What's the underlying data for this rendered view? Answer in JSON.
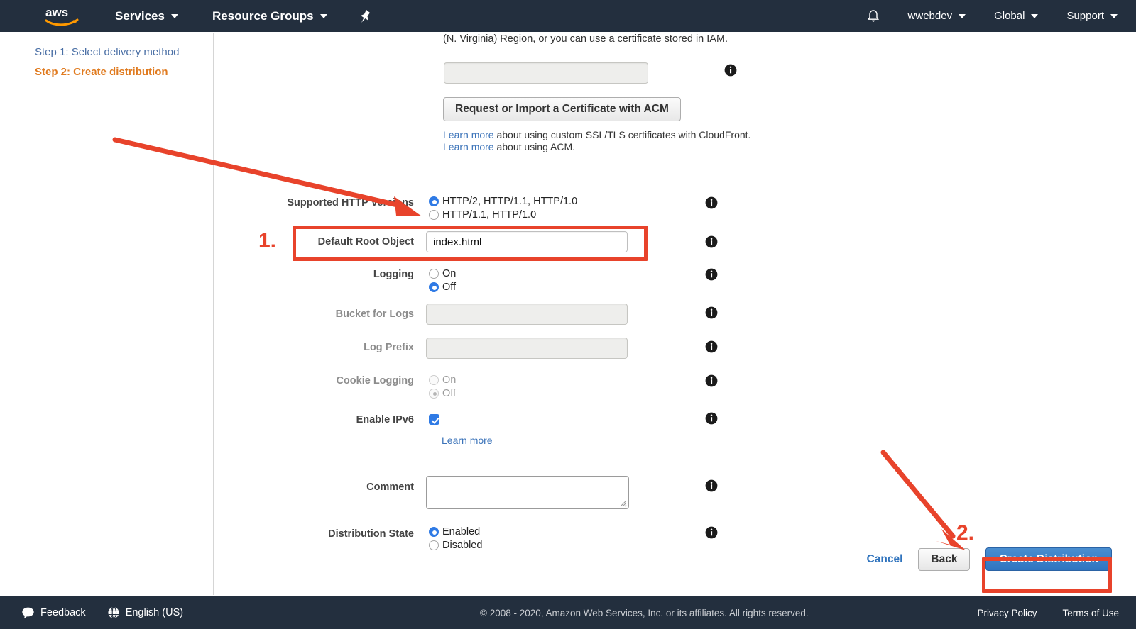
{
  "topnav": {
    "logo_alt": "aws",
    "left_items": [
      {
        "label": "Services",
        "caret": true
      },
      {
        "label": "Resource Groups",
        "caret": true
      }
    ],
    "pin_icon": "pin-icon",
    "bell_icon": "bell-icon",
    "right_items": [
      {
        "label": "wwebdev",
        "caret": true
      },
      {
        "label": "Global",
        "caret": true
      },
      {
        "label": "Support",
        "caret": true
      }
    ]
  },
  "sidebar": {
    "steps": [
      {
        "label": "Step 1: Select delivery method",
        "state": "link"
      },
      {
        "label": "Step 2: Create distribution",
        "state": "current"
      }
    ]
  },
  "main": {
    "intro_text": "(N. Virginia) Region, or you can use a certificate stored in IAM.",
    "certificate_input": {
      "value": "",
      "placeholder": ""
    },
    "acm_button": "Request or Import a Certificate with ACM",
    "learn_more_lines": [
      {
        "link": "Learn more",
        "rest": " about using custom SSL/TLS certificates with CloudFront."
      },
      {
        "link": "Learn more",
        "rest": " about using ACM."
      }
    ],
    "fields": {
      "http_versions": {
        "label": "Supported HTTP Versions",
        "options": [
          {
            "label": "HTTP/2, HTTP/1.1, HTTP/1.0",
            "selected": true
          },
          {
            "label": "HTTP/1.1, HTTP/1.0",
            "selected": false
          }
        ]
      },
      "default_root_object": {
        "label": "Default Root Object",
        "value": "index.html",
        "placeholder": ""
      },
      "logging": {
        "label": "Logging",
        "options": [
          {
            "label": "On",
            "selected": false
          },
          {
            "label": "Off",
            "selected": true
          }
        ]
      },
      "bucket_for_logs": {
        "label": "Bucket for Logs",
        "value": "",
        "disabled": true
      },
      "log_prefix": {
        "label": "Log Prefix",
        "value": "",
        "disabled": true
      },
      "cookie_logging": {
        "label": "Cookie Logging",
        "disabled": true,
        "options": [
          {
            "label": "On",
            "selected": false
          },
          {
            "label": "Off",
            "selected": true
          }
        ]
      },
      "enable_ipv6": {
        "label": "Enable IPv6",
        "checked": true,
        "learn_more": "Learn more"
      },
      "comment": {
        "label": "Comment",
        "value": "",
        "placeholder": ""
      },
      "distribution_state": {
        "label": "Distribution State",
        "options": [
          {
            "label": "Enabled",
            "selected": true
          },
          {
            "label": "Disabled",
            "selected": false
          }
        ]
      }
    },
    "actions": {
      "cancel": "Cancel",
      "back": "Back",
      "create": "Create Distribution"
    }
  },
  "annotations": {
    "step_one_number": "1.",
    "step_two_number": "2.",
    "accent_color": "#e8432b"
  },
  "footer": {
    "feedback": "Feedback",
    "language": "English (US)",
    "copyright": "© 2008 - 2020, Amazon Web Services, Inc. or its affiliates. All rights reserved.",
    "privacy_policy": "Privacy Policy",
    "terms_of_use": "Terms of Use"
  }
}
